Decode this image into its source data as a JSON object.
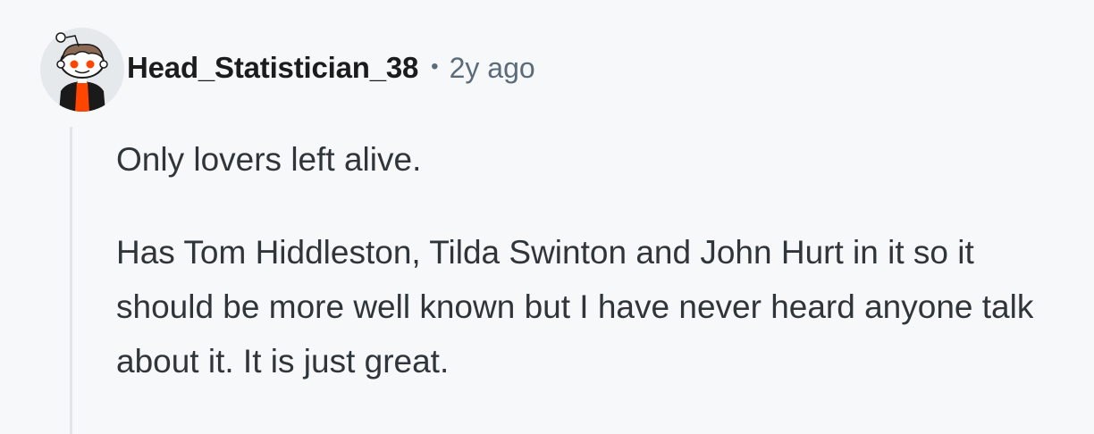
{
  "comment": {
    "author": "Head_Statistician_38",
    "separator": "•",
    "timestamp": "2y ago",
    "avatar_icon": "snoo-avatar-icon",
    "paragraphs": [
      "Only lovers left alive.",
      "Has Tom Hiddleston, Tilda Swinton and John Hurt in it so it should be more well known but I have never heard anyone talk about it. It is just great."
    ]
  },
  "colors": {
    "background": "#f7f8fa",
    "username": "#1c1c1c",
    "meta": "#5b6b78",
    "body_text": "#2f3539",
    "thread_line": "#e1e6ea",
    "avatar_accent": "#ff4500"
  }
}
